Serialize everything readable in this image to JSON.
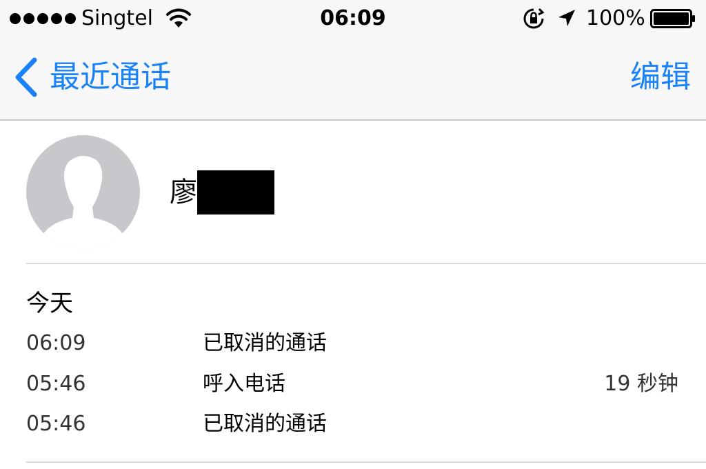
{
  "status_bar": {
    "carrier": "Singtel",
    "time": "06:09",
    "battery": "100%"
  },
  "nav": {
    "back_label": "最近通话",
    "edit_label": "编辑"
  },
  "contact": {
    "name_visible": "廖"
  },
  "calls": {
    "section_title": "今天",
    "rows": [
      {
        "time": "06:09",
        "type": "已取消的通话",
        "duration": ""
      },
      {
        "time": "05:46",
        "type": "呼入电话",
        "duration": "19 秒钟"
      },
      {
        "time": "05:46",
        "type": "已取消的通话",
        "duration": ""
      }
    ]
  },
  "colors": {
    "accent": "#1a82f7",
    "bar_bg": "#f7f7f7",
    "avatar_bg": "#c7c7cc"
  }
}
